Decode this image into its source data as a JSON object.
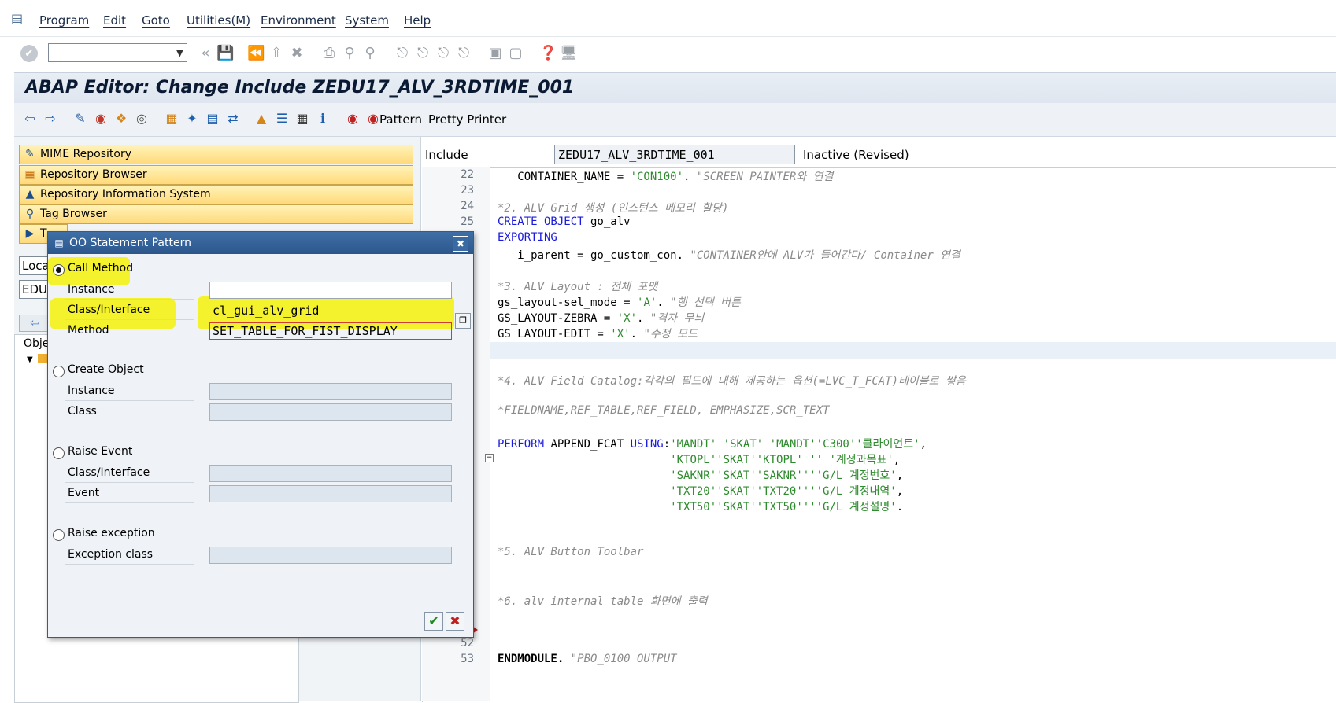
{
  "menubar": {
    "items": [
      "Program",
      "Edit",
      "Goto",
      "Utilities(M)",
      "Environment",
      "System",
      "Help"
    ]
  },
  "title": "ABAP Editor: Change Include ZEDU17_ALV_3RDTIME_001",
  "app_toolbar": {
    "pattern_label": "Pattern",
    "pretty_printer_label": "Pretty Printer"
  },
  "left_panel": {
    "nav": [
      "MIME Repository",
      "Repository Browser",
      "Repository Information System",
      "Tag Browser",
      "T"
    ],
    "field1": "Loca",
    "field2": "EDU",
    "tree_header": "Obje"
  },
  "editor": {
    "include_label": "Include",
    "include_value": "ZEDU17_ALV_3RDTIME_001",
    "status": "Inactive (Revised)",
    "line_numbers": [
      "22",
      "23",
      "24",
      "25",
      "52",
      "53"
    ]
  },
  "dialog": {
    "title": "OO Statement Pattern",
    "call_method": {
      "label": "Call Method",
      "instance_label": "Instance",
      "instance_value": "",
      "class_label": "Class/Interface",
      "class_value": "cl_gui_alv_grid",
      "method_label": "Method",
      "method_value": "SET_TABLE_FOR_FIST_DISPLAY"
    },
    "create_object": {
      "label": "Create Object",
      "instance_label": "Instance",
      "class_label": "Class"
    },
    "raise_event": {
      "label": "Raise Event",
      "class_label": "Class/Interface",
      "event_label": "Event"
    },
    "raise_exception": {
      "label": "Raise exception",
      "exception_label": "Exception class"
    },
    "selected": "Call Method"
  },
  "colors": {
    "keyword": "#1a1adf",
    "string": "#2e8b2e",
    "comment": "#8a8a8a",
    "highlight": "#f5f000",
    "dialog_title": "#2c578c"
  }
}
